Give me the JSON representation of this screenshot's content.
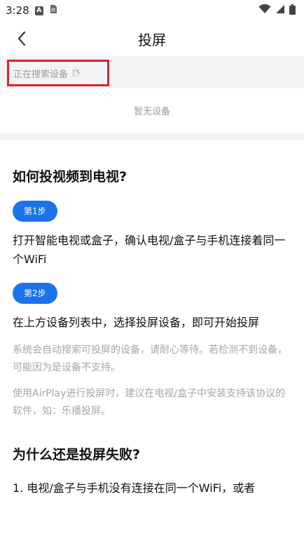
{
  "status_bar": {
    "time": "3:28"
  },
  "header": {
    "title": "投屏"
  },
  "search": {
    "status_text": "正在搜索设备"
  },
  "devices": {
    "empty_text": "暂无设备"
  },
  "guide": {
    "heading": "如何投视频到电视?",
    "step1_label": "第1步",
    "step1_text": "打开智能电视或盒子，确认电视/盒子与手机连接着同一个WiFi",
    "step2_label": "第2步",
    "step2_text": "在上方设备列表中，选择投屏设备，即可开始投屏",
    "hint1": "系统会自动搜索可投屏的设备，请耐心等待。若检测不到设备，可能因为是设备不支持。",
    "hint2": "使用AirPlay进行投屏时，建议在电视/盒子中安装支持该协议的软件，如：乐播投屏。"
  },
  "faq": {
    "heading": "为什么还是投屏失败?",
    "item1": "1. 电视/盒子与手机没有连接在同一个WiFi，或者"
  },
  "colors": {
    "accent": "#1a73e8",
    "highlight": "#e0212b"
  }
}
